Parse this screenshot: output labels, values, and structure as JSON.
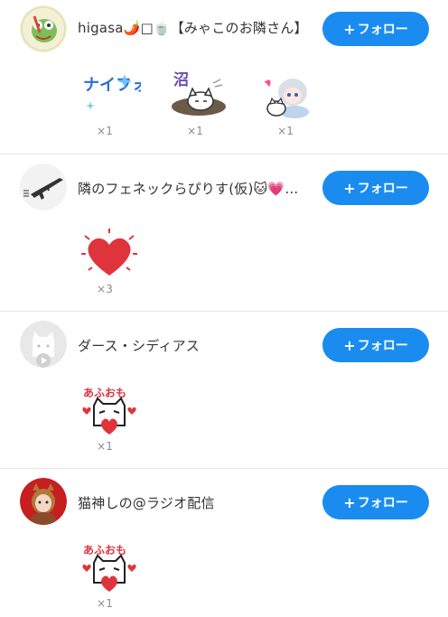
{
  "follow_label": "フォロー",
  "users": [
    {
      "name": "higasa🌶️□🍵【みゃこのお隣さん】",
      "avatar": "frog-avatar",
      "stamps": [
        {
          "name": "nice-follow-stamp",
          "text": "ナイフォロ",
          "count": "×1"
        },
        {
          "name": "numa-cat-stamp",
          "text": "沼",
          "count": "×1"
        },
        {
          "name": "anime-girl-cat-stamp",
          "count": "×1"
        }
      ]
    },
    {
      "name": "隣のフェネックらぴりす(仮)🐱💗…",
      "avatar": "rifle-avatar",
      "stamps": [
        {
          "name": "heart-stamp",
          "count": "×3"
        }
      ]
    },
    {
      "name": "ダース・シディアス",
      "avatar": "default-cat-avatar",
      "stamps": [
        {
          "name": "afuomo-cat-heart-stamp",
          "text": "あふおも",
          "count": "×1"
        }
      ]
    },
    {
      "name": "猫神しの@ラジオ配信",
      "avatar": "cat-girl-avatar",
      "stamps": [
        {
          "name": "afuomo-cat-heart-stamp",
          "text": "あふおも",
          "count": "×1"
        }
      ]
    }
  ],
  "colors": {
    "accent": "#1a8cf0",
    "heart": "#e0343c",
    "count_text": "#8a8a8a"
  }
}
